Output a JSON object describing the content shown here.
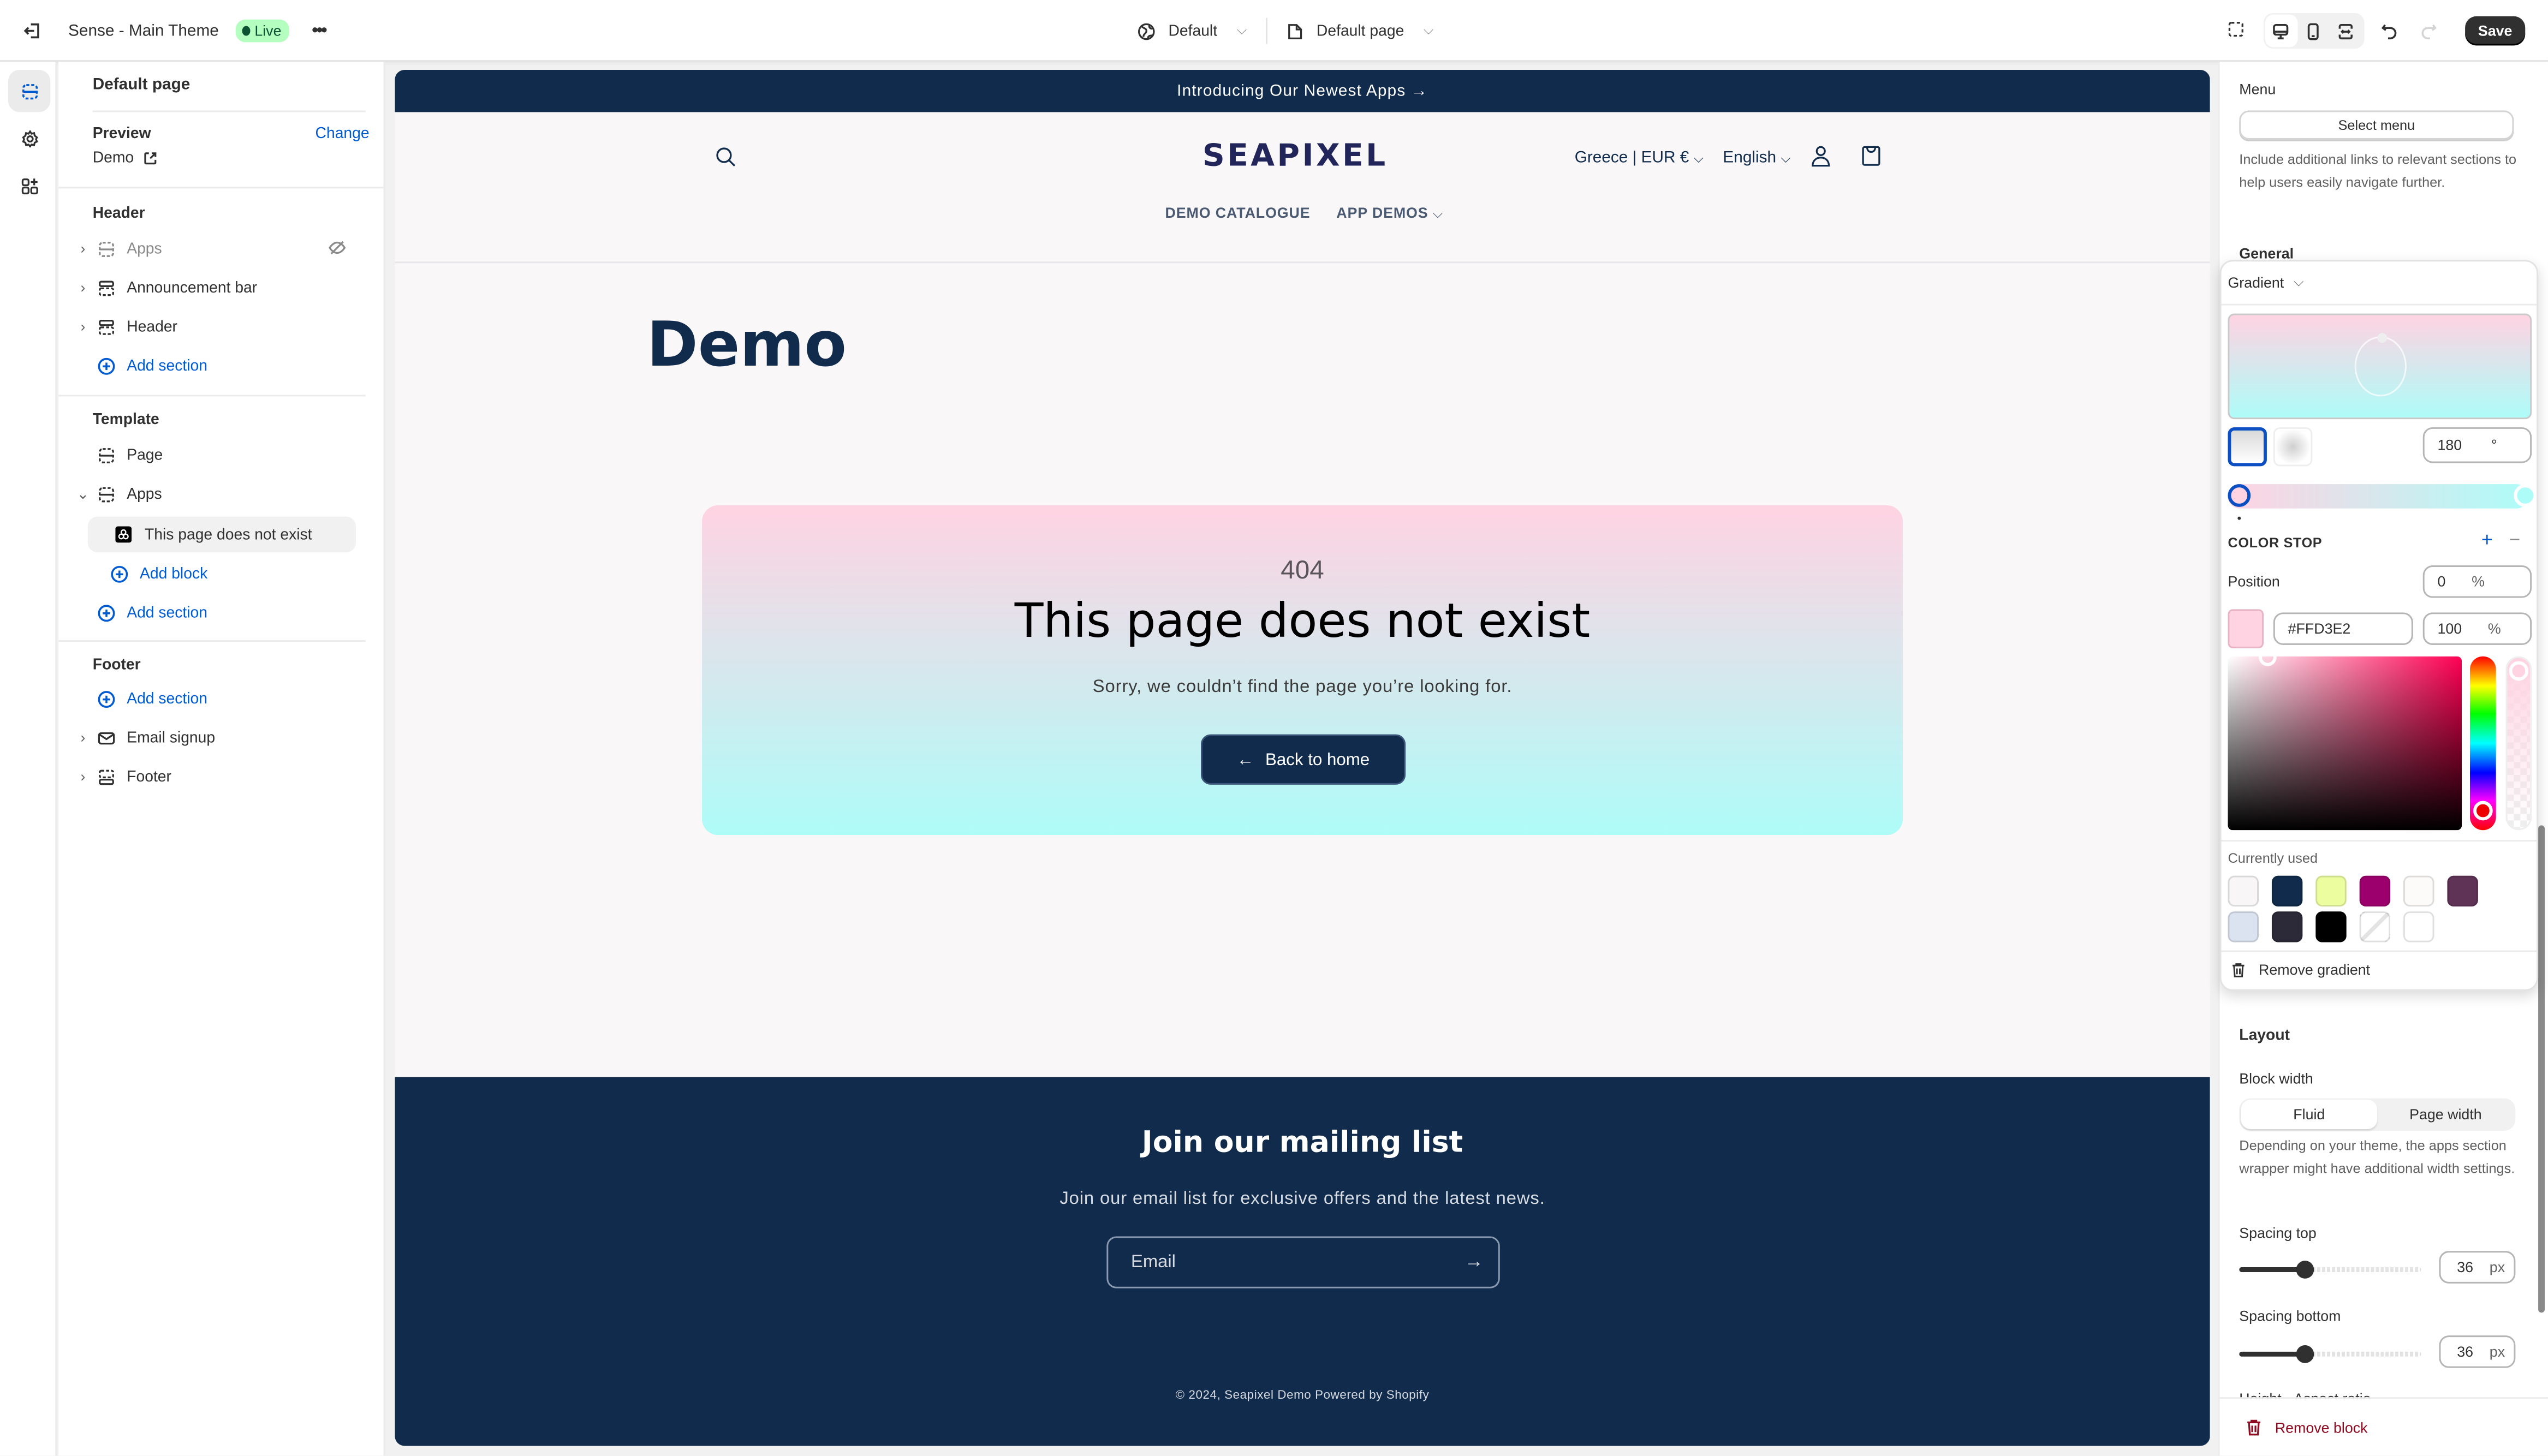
{
  "topbar": {
    "theme_name": "Sense - Main Theme",
    "live_badge": "Live",
    "market_selector": "Default",
    "page_selector": "Default page",
    "save_label": "Save"
  },
  "sidebar": {
    "title": "Default page",
    "preview_label": "Preview",
    "change_link": "Change",
    "preview_value": "Demo",
    "groups": {
      "header": {
        "label": "Header",
        "items": [
          "Apps",
          "Announcement bar",
          "Header"
        ],
        "add_section": "Add section"
      },
      "template": {
        "label": "Template",
        "items": [
          "Page",
          "Apps"
        ],
        "block": "This page does not exist",
        "add_block": "Add block",
        "add_section": "Add section"
      },
      "footer": {
        "label": "Footer",
        "add_section": "Add section",
        "items": [
          "Email signup",
          "Footer"
        ]
      }
    }
  },
  "preview": {
    "announcement": "Introducing Our Newest Apps →",
    "logo": "SEAPIXEL",
    "country": "Greece | EUR €",
    "language": "English",
    "nav": [
      "DEMO CATALOGUE",
      "APP DEMOS"
    ],
    "page_title": "Demo",
    "error_code": "404",
    "error_title": "This page does not exist",
    "error_message": "Sorry, we couldn’t find the page you’re looking for.",
    "back_button": "Back to home",
    "gradient": {
      "from": "#FFD3E2",
      "to": "#AEFCF8"
    },
    "newsletter_title": "Join our mailing list",
    "newsletter_sub": "Join our email list for exclusive offers and the latest news.",
    "email_placeholder": "Email",
    "copyright": "© 2024, Seapixel Demo Powered by Shopify",
    "brand_color": "#102B4C"
  },
  "settings": {
    "menu_label": "Menu",
    "select_menu": "Select menu",
    "menu_help": "Include additional links to relevant sections to help users easily navigate further.",
    "general_label": "General",
    "layout_label": "Layout",
    "block_width_label": "Block width",
    "block_width_options": [
      "Fluid",
      "Page width"
    ],
    "block_width_selected": "Fluid",
    "block_width_help": "Depending on your theme, the apps section wrapper might have additional width settings.",
    "spacing_top_label": "Spacing top",
    "spacing_top_value": "36",
    "spacing_top_fraction": 0.36,
    "spacing_bottom_label": "Spacing bottom",
    "spacing_bottom_value": "36",
    "spacing_bottom_fraction": 0.36,
    "unit_px": "px",
    "height_label": "Height - Aspect ratio",
    "remove_block": "Remove block"
  },
  "gradient_picker": {
    "type": "Gradient",
    "angle": "180",
    "angle_unit": "°",
    "color_stop_label": "COLOR STOP",
    "position_label": "Position",
    "position_value": "0",
    "percent_unit": "%",
    "hex_value": "#FFD3E2",
    "opacity_value": "100",
    "currently_used_label": "Currently used",
    "swatches": [
      "#F8F6F7",
      "#102B4C",
      "#ECFDA0",
      "#9C006C",
      "#FCFBFA",
      "#5E3355",
      "#DCE3F0",
      "#2C2A38",
      "#000000",
      "none",
      "#FFFFFF"
    ],
    "remove_gradient": "Remove gradient"
  }
}
